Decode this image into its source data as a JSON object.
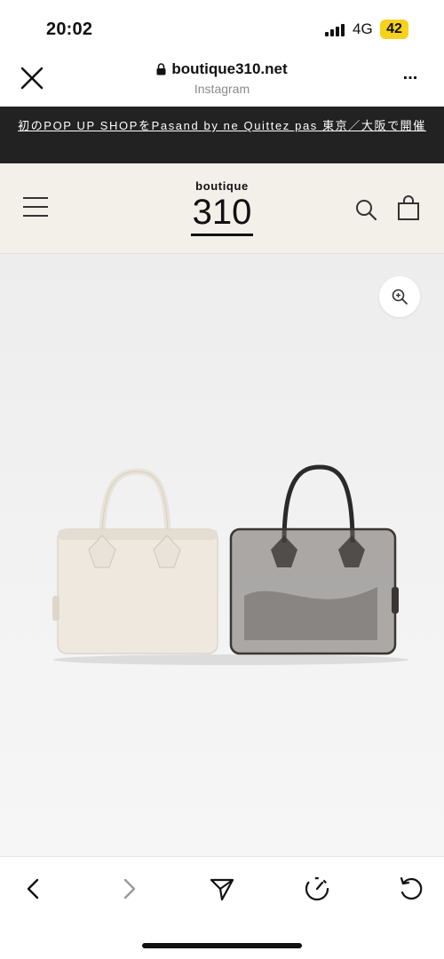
{
  "status_bar": {
    "time": "20:02",
    "network": "4G",
    "battery": "42"
  },
  "browser": {
    "url": "boutique310.net",
    "source": "Instagram",
    "more_label": "..."
  },
  "announcement": {
    "text": "初のPOP UP SHOPをPasand by ne Quittez pas 東京／大阪で開催"
  },
  "site_header": {
    "logo_top": "boutique",
    "logo_number": "310"
  },
  "colors": {
    "announcement_bg": "#222222",
    "header_bg": "#f3efe9",
    "battery": "#f7d21a"
  },
  "icons": {
    "close": "close-icon",
    "lock": "lock-icon",
    "menu": "hamburger-menu-icon",
    "search": "search-icon",
    "bag": "shopping-bag-icon",
    "zoom": "zoom-in-icon",
    "back": "chevron-left-icon",
    "forward": "chevron-right-icon",
    "share": "send-icon",
    "speed": "speedometer-icon",
    "refresh": "refresh-icon"
  }
}
